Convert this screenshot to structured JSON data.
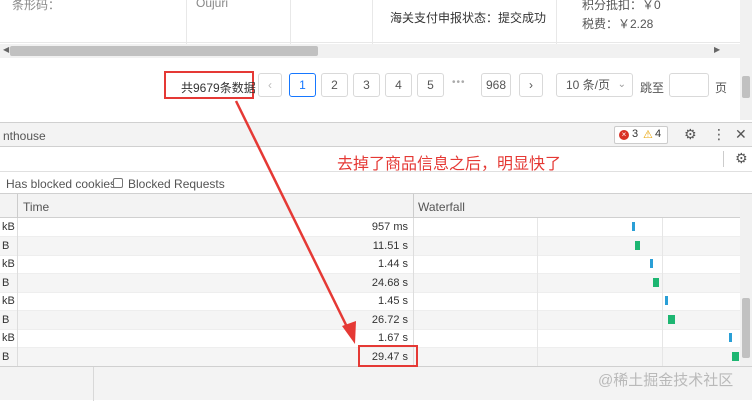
{
  "top_table": {
    "col1_label": "条形码：",
    "col2_value": "Oujuri",
    "customs_status": "海关支付申报状态：提交成功",
    "points_label": "积分抵扣：￥0",
    "tax_label": "税费：￥2.28"
  },
  "pagination": {
    "total": "共9679条数据",
    "prev_icon": "‹",
    "pages": [
      "1",
      "2",
      "3",
      "4",
      "5"
    ],
    "ellipsis": "•••",
    "last_page": "968",
    "next_icon": "›",
    "page_size": "10 条/页",
    "jump_label": "跳至",
    "page_unit": "页"
  },
  "devtools": {
    "tab_label": "nthouse",
    "error_count": "3",
    "warning_count": "4",
    "annotation": "去掉了商品信息之后，明显快了",
    "has_blocked_cookies": "Has blocked cookies",
    "blocked_requests": "Blocked Requests",
    "col_time": "Time",
    "col_waterfall": "Waterfall",
    "rows": [
      {
        "size": "kB",
        "time": "957 ms"
      },
      {
        "size": "B",
        "time": "11.51 s"
      },
      {
        "size": "kB",
        "time": "1.44 s"
      },
      {
        "size": "B",
        "time": "24.68 s"
      },
      {
        "size": "kB",
        "time": "1.45 s"
      },
      {
        "size": "B",
        "time": "26.72 s"
      },
      {
        "size": "kB",
        "time": "1.67 s"
      },
      {
        "size": "B",
        "time": "29.47 s"
      }
    ]
  },
  "watermark": "@稀土掘金技术社区",
  "colors": {
    "accent": "#1677ff",
    "highlight": "#e53935",
    "bar_green": "#1db672",
    "bar_blue": "#2a9fd6"
  }
}
